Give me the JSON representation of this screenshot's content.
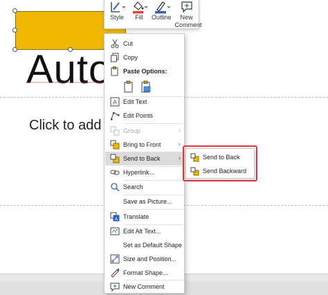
{
  "slide": {
    "title_text": "Auto",
    "subtitle_text": "Click to add"
  },
  "mini_toolbar": {
    "style_label": "Style",
    "fill_label": "Fill",
    "outline_label": "Outline",
    "new_comment_label": "New Comment",
    "fill_color": "#e8423c",
    "outline_color": "#2b62c3"
  },
  "context_menu": {
    "cut": "Cut",
    "copy": "Copy",
    "paste_options": "Paste Options:",
    "edit_text": "Edit Text",
    "edit_points": "Edit Points",
    "group": "Group",
    "bring_to_front": "Bring to Front",
    "send_to_back": "Send to Back",
    "hyperlink": "Hyperlink...",
    "search": "Search",
    "save_as_picture": "Save as Picture...",
    "translate": "Translate",
    "edit_alt_text": "Edit Alt Text...",
    "set_default_shape": "Set as Default Shape",
    "size_and_position": "Size and Position...",
    "format_shape": "Format Shape...",
    "new_comment": "New Comment",
    "submenu_arrow": "›"
  },
  "submenu": {
    "send_to_back": "Send to Back",
    "send_backward": "Send Backward"
  },
  "colors": {
    "shape_fill": "#f0b800",
    "highlight_border": "#e0393e",
    "hover_bg": "#dcdcdc"
  }
}
